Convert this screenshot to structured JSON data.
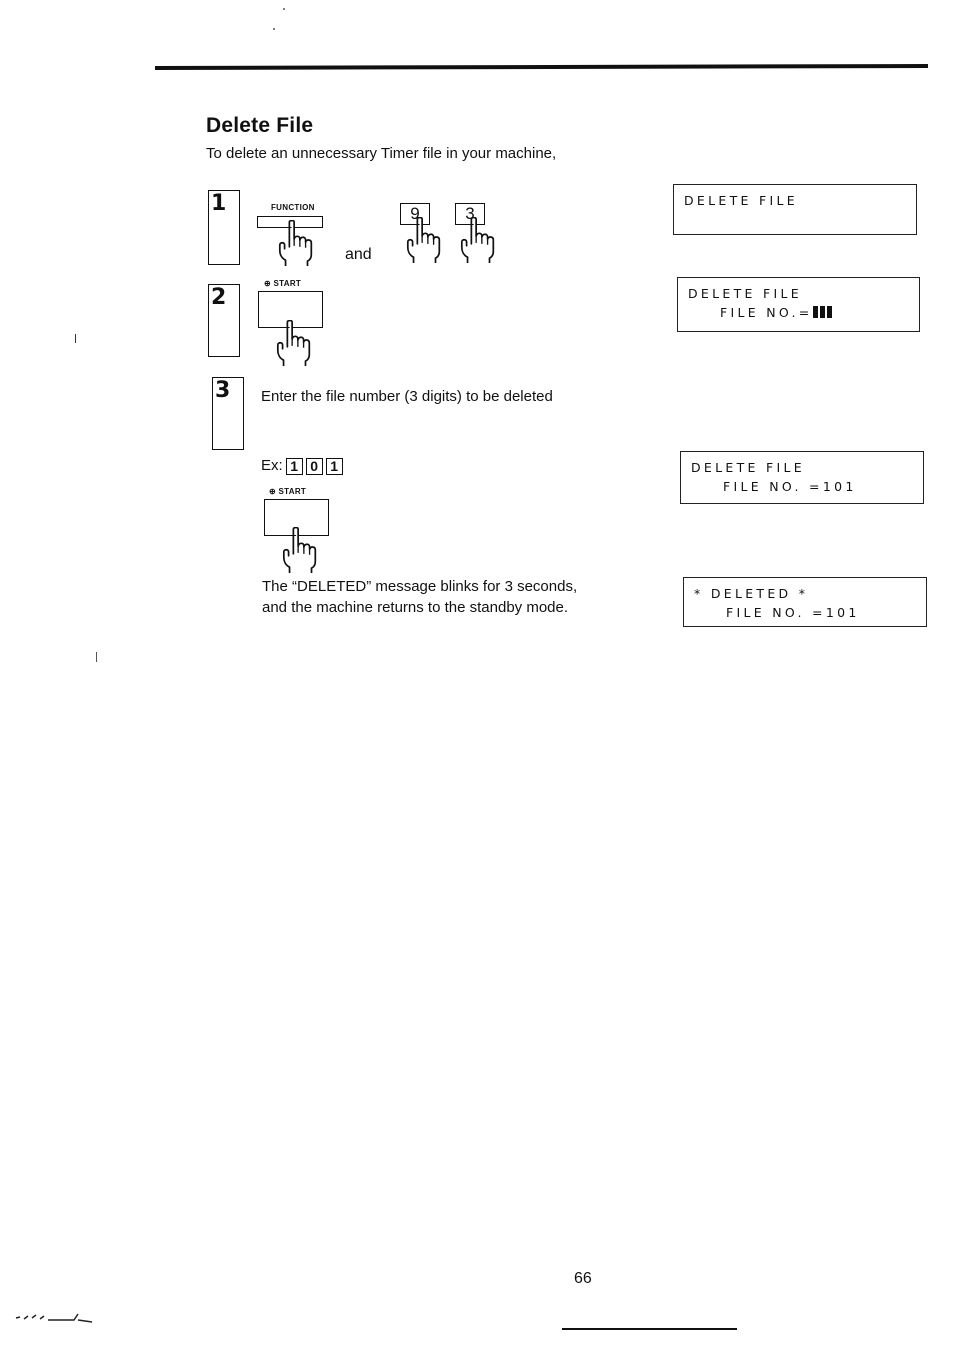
{
  "section": {
    "title": "Delete File",
    "intro": "To delete an unnecessary Timer file in your machine,"
  },
  "steps": [
    {
      "number": "1",
      "keys": {
        "function_label": "FUNCTION",
        "connector": "and",
        "digit_keys": [
          "9",
          "3"
        ]
      }
    },
    {
      "number": "2",
      "keys": {
        "start_label": "⊕ START"
      }
    },
    {
      "number": "3",
      "instruction": "Enter the file number (3 digits) to be deleted",
      "example_prefix": "Ex:",
      "example_keys": [
        "1",
        "0",
        "1"
      ],
      "start_label": "⊕ START",
      "result_line1": "The “DELETED” message blinks for 3 seconds,",
      "result_line2": "and the machine returns to the standby mode."
    }
  ],
  "lcd_displays": [
    {
      "line1": "DELETE FILE",
      "line2": ""
    },
    {
      "line1": "DELETE FILE",
      "line2": "FILE NO.=",
      "cursor_blocks": 3
    },
    {
      "line1": "DELETE FILE",
      "line2": "FILE NO. =101"
    },
    {
      "line1": "* DELETED *",
      "line2": "FILE NO. =101"
    }
  ],
  "footer": {
    "page_number": "66"
  },
  "icons": {
    "pressing_hand": "hand-pointing-finger-icon"
  }
}
